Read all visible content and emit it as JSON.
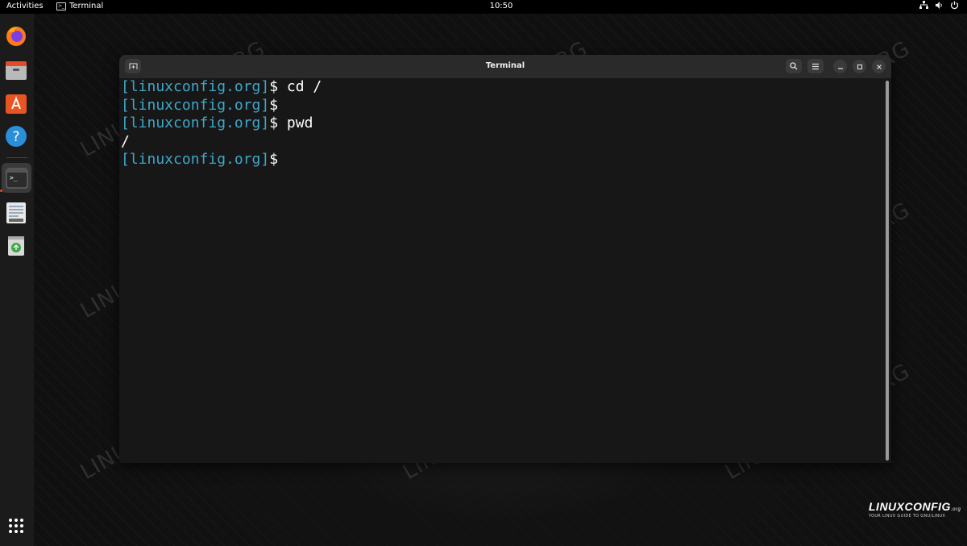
{
  "topbar": {
    "activities_label": "Activities",
    "app_name": "Terminal",
    "clock": "10:50",
    "tray_icons": [
      "network-icon",
      "volume-icon",
      "power-icon"
    ]
  },
  "dock": {
    "items": [
      {
        "name": "firefox-icon"
      },
      {
        "name": "files-icon"
      },
      {
        "name": "app-center-icon"
      },
      {
        "name": "help-icon"
      },
      {
        "name": "terminal-icon",
        "active": true
      },
      {
        "name": "text-editor-icon"
      },
      {
        "name": "trash-icon"
      }
    ],
    "show_apps_icon": "app-grid-icon"
  },
  "window": {
    "title": "Terminal",
    "new_tab_icon": "new-tab-icon",
    "search_icon": "search-icon",
    "menu_icon": "hamburger-menu-icon",
    "minimize_icon": "minimize-icon",
    "maximize_icon": "maximize-icon",
    "close_icon": "close-icon"
  },
  "terminal": {
    "lines": [
      {
        "prompt": "[linuxconfig.org]",
        "text": "$ cd /"
      },
      {
        "prompt": "[linuxconfig.org]",
        "text": "$"
      },
      {
        "prompt": "[linuxconfig.org]",
        "text": "$ pwd"
      },
      {
        "prompt": "",
        "text": "/"
      },
      {
        "prompt": "[linuxconfig.org]",
        "text": "$"
      }
    ]
  },
  "watermark": {
    "text": "LINUXCONFIG.ORG"
  },
  "logo": {
    "brand": "LINUXCONFIG",
    "suffix": ".org",
    "tagline": "YOUR LINUX GUIDE TO GNU/LINUX"
  },
  "colors": {
    "prompt": "#3fa7c8",
    "accent": "#e95420"
  }
}
